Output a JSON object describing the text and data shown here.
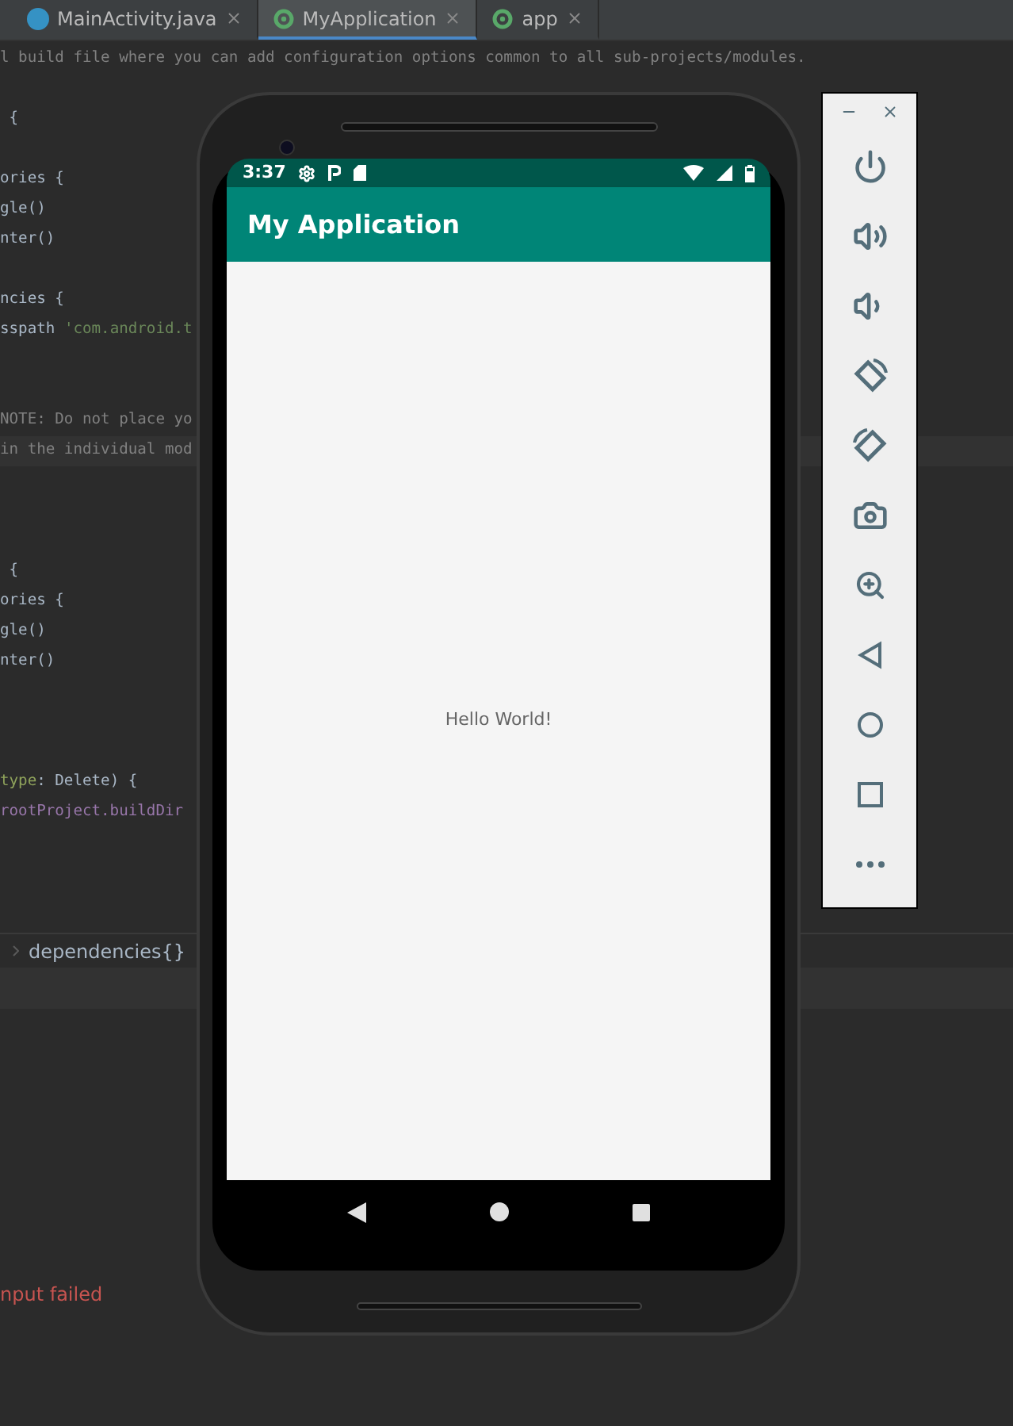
{
  "tabs": [
    {
      "label": "MainActivity.java",
      "kind": "java",
      "selected": false
    },
    {
      "label": "MyApplication",
      "kind": "gradle",
      "selected": true
    },
    {
      "label": "app",
      "kind": "gradle",
      "selected": false
    }
  ],
  "code_lines": [
    {
      "kind": "code",
      "segments": [
        {
          "kind": "comment",
          "text": "l build file where you can add configuration options common to all sub-projects/modules."
        }
      ]
    },
    {
      "kind": "blank"
    },
    {
      "kind": "code",
      "segments": [
        {
          "kind": "plain",
          "text": " {"
        }
      ]
    },
    {
      "kind": "blank"
    },
    {
      "kind": "code",
      "segments": [
        {
          "kind": "plain",
          "text": "ories {"
        }
      ]
    },
    {
      "kind": "code",
      "segments": [
        {
          "kind": "plain",
          "text": "gle()"
        }
      ]
    },
    {
      "kind": "code",
      "segments": [
        {
          "kind": "plain",
          "text": "nter()"
        }
      ]
    },
    {
      "kind": "blank"
    },
    {
      "kind": "code",
      "segments": [
        {
          "kind": "plain",
          "text": "ncies {"
        }
      ]
    },
    {
      "kind": "code",
      "segments": [
        {
          "kind": "plain",
          "text": "sspath "
        },
        {
          "kind": "string",
          "text": "'com.android.t"
        }
      ]
    },
    {
      "kind": "blank"
    },
    {
      "kind": "blank"
    },
    {
      "kind": "code",
      "segments": [
        {
          "kind": "comment",
          "text": "NOTE: Do not place yo"
        }
      ]
    },
    {
      "kind": "code",
      "current": true,
      "segments": [
        {
          "kind": "comment",
          "text": "in the individual mod"
        }
      ]
    },
    {
      "kind": "blank"
    },
    {
      "kind": "blank"
    },
    {
      "kind": "blank"
    },
    {
      "kind": "code",
      "segments": [
        {
          "kind": "plain",
          "text": " {"
        }
      ]
    },
    {
      "kind": "code",
      "segments": [
        {
          "kind": "plain",
          "text": "ories {"
        }
      ]
    },
    {
      "kind": "code",
      "segments": [
        {
          "kind": "plain",
          "text": "gle()"
        }
      ]
    },
    {
      "kind": "code",
      "segments": [
        {
          "kind": "plain",
          "text": "nter()"
        }
      ]
    },
    {
      "kind": "blank"
    },
    {
      "kind": "blank"
    },
    {
      "kind": "blank"
    },
    {
      "kind": "code",
      "segments": [
        {
          "kind": "named",
          "text": "type"
        },
        {
          "kind": "plain",
          "text": ": Delete) {"
        }
      ]
    },
    {
      "kind": "code",
      "segments": [
        {
          "kind": "field",
          "text": "rootProject.buildDir"
        }
      ]
    }
  ],
  "breadcrumb": "dependencies{}",
  "output_error": "nput failed",
  "phone": {
    "time": "3:37",
    "app_title": "My Application",
    "content_text": "Hello World!"
  }
}
